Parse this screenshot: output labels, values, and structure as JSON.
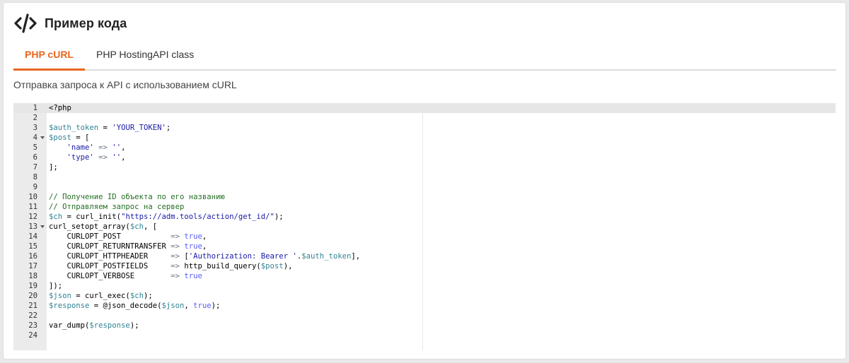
{
  "header": {
    "icon": "code-icon",
    "title": "Пример кода"
  },
  "tabs": [
    {
      "label": "PHP cURL",
      "active": true
    },
    {
      "label": "PHP HostingAPI class",
      "active": false
    }
  ],
  "description": "Отправка запроса к API с использованием cURL",
  "colors": {
    "accent": "#e8661d",
    "variable": "#318495",
    "string": "#1a1aa6",
    "comment": "#236e24",
    "constant": "#585cf6"
  },
  "editor": {
    "line_count": 24,
    "foldable_lines": [
      4,
      13
    ],
    "lines": [
      [
        [
          "t",
          "<?php"
        ]
      ],
      [],
      [
        [
          "v",
          "$auth_token"
        ],
        [
          "t",
          " = "
        ],
        [
          "s",
          "'YOUR_TOKEN'"
        ],
        [
          "t",
          ";"
        ]
      ],
      [
        [
          "v",
          "$post"
        ],
        [
          "t",
          " = ["
        ]
      ],
      [
        [
          "t",
          "    "
        ],
        [
          "s",
          "'name'"
        ],
        [
          "o",
          " => "
        ],
        [
          "s",
          "''"
        ],
        [
          "t",
          ","
        ]
      ],
      [
        [
          "t",
          "    "
        ],
        [
          "s",
          "'type'"
        ],
        [
          "o",
          " => "
        ],
        [
          "s",
          "''"
        ],
        [
          "t",
          ","
        ]
      ],
      [
        [
          "t",
          "];"
        ]
      ],
      [],
      [],
      [
        [
          "c",
          "// Получение ID объекта по его названию"
        ]
      ],
      [
        [
          "c",
          "// Отправляем запрос на сервер"
        ]
      ],
      [
        [
          "v",
          "$ch"
        ],
        [
          "t",
          " = curl_init("
        ],
        [
          "s",
          "\"https://adm.tools/action/get_id/\""
        ],
        [
          "t",
          ");"
        ]
      ],
      [
        [
          "t",
          "curl_setopt_array("
        ],
        [
          "v",
          "$ch"
        ],
        [
          "t",
          ", ["
        ]
      ],
      [
        [
          "t",
          "    CURLOPT_POST           "
        ],
        [
          "o",
          "=> "
        ],
        [
          "b",
          "true"
        ],
        [
          "t",
          ","
        ]
      ],
      [
        [
          "t",
          "    CURLOPT_RETURNTRANSFER "
        ],
        [
          "o",
          "=> "
        ],
        [
          "b",
          "true"
        ],
        [
          "t",
          ","
        ]
      ],
      [
        [
          "t",
          "    CURLOPT_HTTPHEADER     "
        ],
        [
          "o",
          "=> "
        ],
        [
          "t",
          "["
        ],
        [
          "s",
          "'Authorization: Bearer '"
        ],
        [
          "t",
          "."
        ],
        [
          "v",
          "$auth_token"
        ],
        [
          "t",
          "],"
        ]
      ],
      [
        [
          "t",
          "    CURLOPT_POSTFIELDS     "
        ],
        [
          "o",
          "=> "
        ],
        [
          "t",
          "http_build_query("
        ],
        [
          "v",
          "$post"
        ],
        [
          "t",
          "),"
        ]
      ],
      [
        [
          "t",
          "    CURLOPT_VERBOSE        "
        ],
        [
          "o",
          "=> "
        ],
        [
          "b",
          "true"
        ]
      ],
      [
        [
          "t",
          "]);"
        ]
      ],
      [
        [
          "v",
          "$json"
        ],
        [
          "t",
          " = curl_exec("
        ],
        [
          "v",
          "$ch"
        ],
        [
          "t",
          ");"
        ]
      ],
      [
        [
          "v",
          "$response"
        ],
        [
          "t",
          " = @json_decode("
        ],
        [
          "v",
          "$json"
        ],
        [
          "t",
          ", "
        ],
        [
          "b",
          "true"
        ],
        [
          "t",
          ");"
        ]
      ],
      [],
      [
        [
          "t",
          "var_dump("
        ],
        [
          "v",
          "$response"
        ],
        [
          "t",
          ");"
        ]
      ],
      []
    ]
  }
}
